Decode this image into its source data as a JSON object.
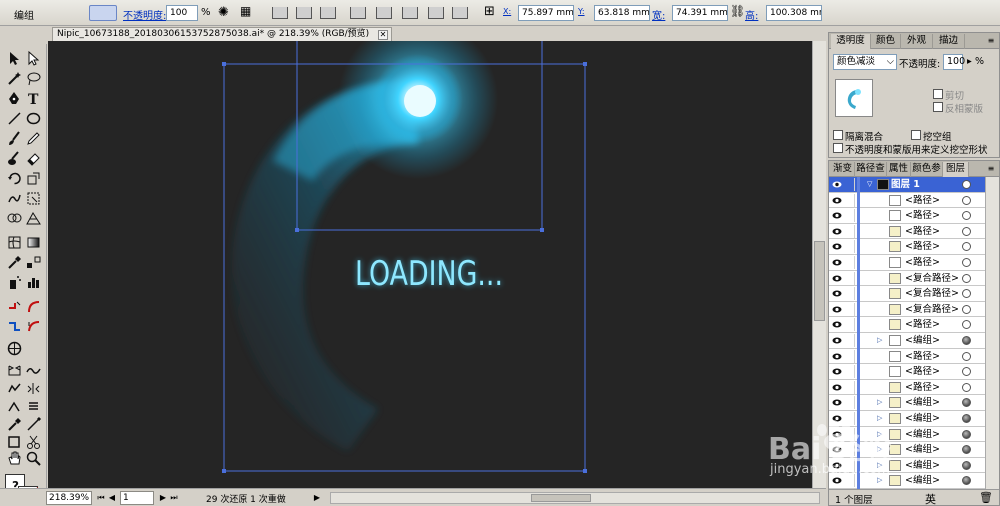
{
  "control_bar": {
    "selection_label": "编组",
    "opacity_label": "不透明度:",
    "opacity_value": "100",
    "opacity_unit": "%",
    "x_label": "X:",
    "x_value": "75.897 mm",
    "y_label": "Y:",
    "y_value": "63.818 mm",
    "w_label": "宽:",
    "w_value": "74.391 mm",
    "h_label": "高:",
    "h_value": "100.308 mm"
  },
  "document": {
    "tab_title": "Nipic_10673188_20180306153752875038.ai* @ 218.39% (RGB/预览)",
    "close_glyph": "✕"
  },
  "artwork": {
    "loading_text": "LOADING...",
    "accent_color": "#3fd4ff",
    "canvas_color": "#252525",
    "selection_color": "#4a6fdc"
  },
  "status_bar": {
    "zoom": "218.39%",
    "page": "1",
    "undo_text": "29 次还原 1 次重做"
  },
  "transparency_panel": {
    "tabs": [
      "透明度",
      "颜色",
      "外观",
      "描边"
    ],
    "blend_mode": "颜色减淡",
    "opacity_label": "不透明度:",
    "opacity_value": "100",
    "opacity_unit": "%",
    "clip_label": "剪切",
    "invert_mask_label": "反相蒙版",
    "isolate_label": "隔离混合",
    "knockout_label": "挖空组",
    "opacity_mask_label": "不透明度和蒙版用来定义挖空形状"
  },
  "layers_panel": {
    "tabs": [
      "渐变",
      "路径查",
      "属性",
      "颜色参",
      "图层"
    ],
    "layer_name": "图层 1",
    "items": [
      {
        "name": "<路径>",
        "target": "empty",
        "thumb": "#ffffff",
        "twirl": ""
      },
      {
        "name": "<路径>",
        "target": "empty",
        "thumb": "#ffffff",
        "twirl": ""
      },
      {
        "name": "<路径>",
        "target": "empty",
        "thumb": "#f5f0c8",
        "twirl": ""
      },
      {
        "name": "<路径>",
        "target": "empty",
        "thumb": "#f5f0c8",
        "twirl": ""
      },
      {
        "name": "<路径>",
        "target": "empty",
        "thumb": "#ffffff",
        "twirl": ""
      },
      {
        "name": "<复合路径>",
        "target": "empty",
        "thumb": "#f5f0c8",
        "twirl": ""
      },
      {
        "name": "<复合路径>",
        "target": "empty",
        "thumb": "#f5f0c8",
        "twirl": ""
      },
      {
        "name": "<复合路径>",
        "target": "empty",
        "thumb": "#f5f0c8",
        "twirl": ""
      },
      {
        "name": "<路径>",
        "target": "empty",
        "thumb": "#f5f0c8",
        "twirl": ""
      },
      {
        "name": "<编组>",
        "target": "full",
        "thumb": "#ffffff",
        "twirl": "▷"
      },
      {
        "name": "<路径>",
        "target": "empty",
        "thumb": "#ffffff",
        "twirl": ""
      },
      {
        "name": "<路径>",
        "target": "empty",
        "thumb": "#ffffff",
        "twirl": ""
      },
      {
        "name": "<路径>",
        "target": "empty",
        "thumb": "#f5f0c8",
        "twirl": ""
      },
      {
        "name": "<编组>",
        "target": "full",
        "thumb": "#f5f0c8",
        "twirl": "▷"
      },
      {
        "name": "<编组>",
        "target": "full",
        "thumb": "#f5f0c8",
        "twirl": "▷"
      },
      {
        "name": "<编组>",
        "target": "full",
        "thumb": "#f5f0c8",
        "twirl": "▷"
      },
      {
        "name": "<编组>",
        "target": "full",
        "thumb": "#f5f0c8",
        "twirl": "▷"
      },
      {
        "name": "<编组>",
        "target": "full",
        "thumb": "#f5f0c8",
        "twirl": "▷"
      },
      {
        "name": "<编组>",
        "target": "full",
        "thumb": "#f5f0c8",
        "twirl": "▷"
      }
    ],
    "footer_text": "1 个图层"
  },
  "watermark": {
    "brand": "Bai 经验",
    "url": "jingyan.baidu.com"
  },
  "ime": {
    "label": "英"
  }
}
